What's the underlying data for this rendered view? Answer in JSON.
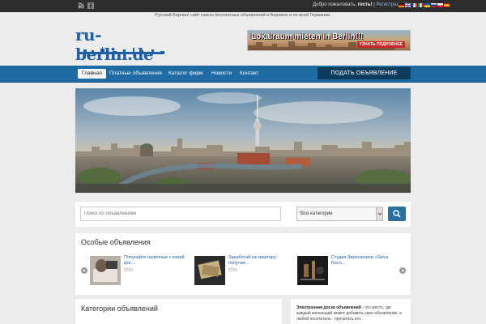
{
  "topbar": {
    "welcome_prefix": "Добро пожаловать,",
    "guest": "гость!",
    "registration": "Регистрация",
    "social_icons": [
      "rss-icon",
      "facebook-icon"
    ],
    "language_flags": [
      "de-flag",
      "gb-flag",
      "fr-flag",
      "it-flag",
      "ua-flag",
      "ru-flag",
      "pl-flag",
      "es-flag"
    ]
  },
  "header": {
    "tagline": "Русский Берлин! сайт газета бесплатных объявлений в Берлине и по всей Германии.",
    "logo_text": "ru-berlin.de",
    "ad_title": "Lokalraum mieten in Berlin!!!",
    "ad_cta": "УЗНАТЬ ПОДРОБНЕЕ"
  },
  "nav": {
    "items": [
      {
        "label": "Главная",
        "active": true
      },
      {
        "label": "Платные объявления",
        "active": false
      },
      {
        "label": "Каталог фирм",
        "active": false
      },
      {
        "label": "Новости",
        "active": false
      },
      {
        "label": "Контакт",
        "active": false
      }
    ],
    "post_button": "ПОДАТЬ ОБЪЯВЛЕНИЕ"
  },
  "search": {
    "placeholder": "Поиск по объявлениям",
    "category_selected": "Все категории"
  },
  "featured": {
    "title": "Особые объявления",
    "items": [
      {
        "title": "Получайте наличные с копий кре...",
        "price": "€250"
      },
      {
        "title": "Заработай на квартиру получая ...",
        "price": "€250"
      },
      {
        "title": "Студия Звукозаписи «Slava Reco...",
        "price": ""
      }
    ]
  },
  "categories": {
    "title": "Категории объявлений"
  },
  "about": {
    "bold": "Электронная доска объявлений",
    "text": " - это место, где каждый желающий может добавить свое объявление, а любой посетитель - прочитать его."
  },
  "colors": {
    "nav_blue": "#1e6aa4",
    "post_button": "#0d3d5e",
    "topbar": "#2d2d2d",
    "link": "#1f5fa5"
  }
}
